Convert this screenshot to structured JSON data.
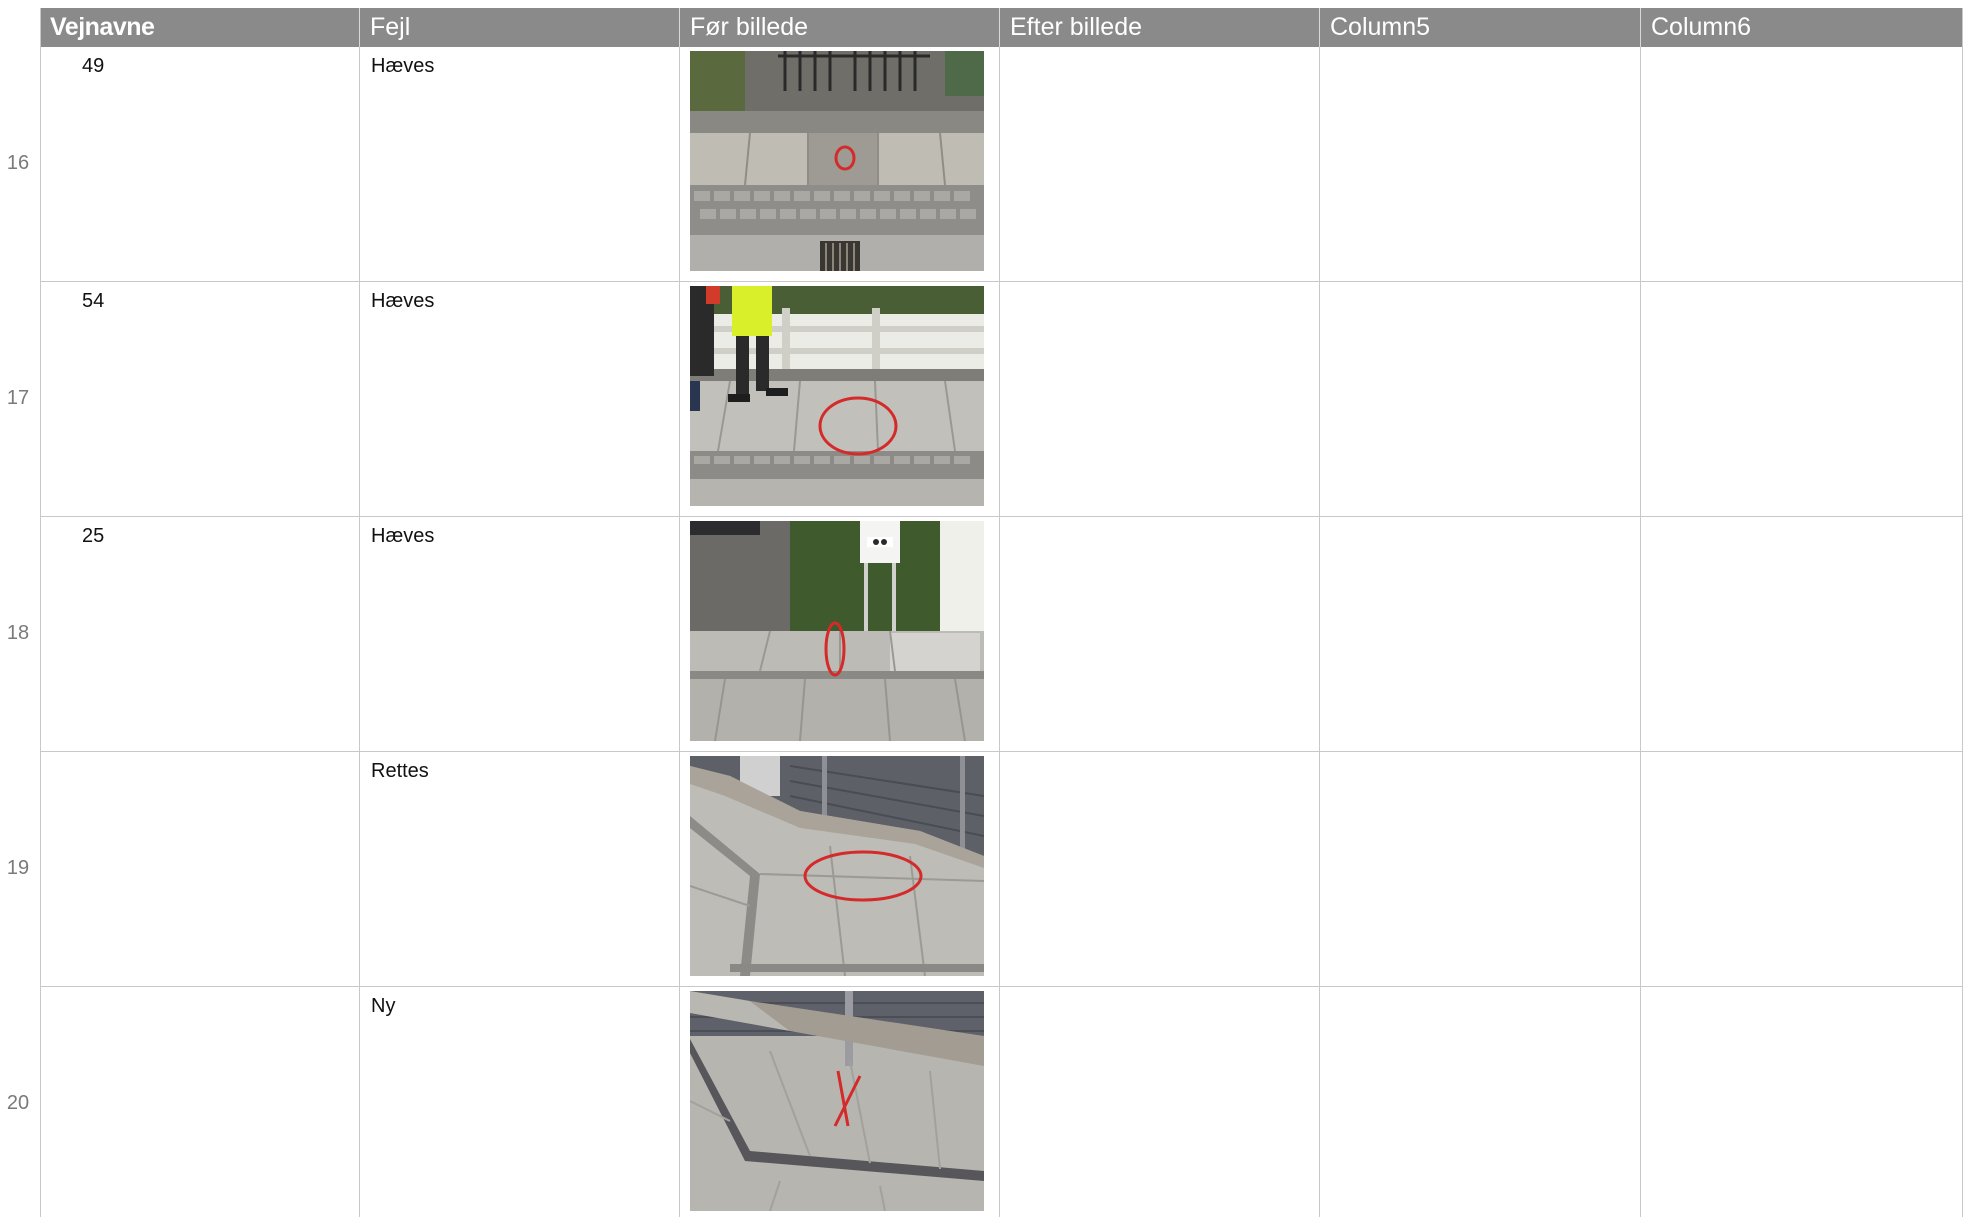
{
  "sheet": {
    "columns": [
      "Vejnavne",
      "Fejl",
      "Før billede",
      "Efter billede",
      "Column5",
      "Column6"
    ],
    "rows": [
      {
        "row_number": "16",
        "vejnavne": "49",
        "fejl": "Hæves",
        "foer_billede": "photo: paving slab near gate, red circle marking defect"
      },
      {
        "row_number": "17",
        "vejnavne": "54",
        "fejl": "Hæves",
        "foer_billede": "photo: sidewalk by white fence, workers, red circle marking defect"
      },
      {
        "row_number": "18",
        "vejnavne": "25",
        "fejl": "Hæves",
        "foer_billede": "photo: sidewalk near hedge and house number sign, red mark on defect"
      },
      {
        "row_number": "19",
        "vejnavne": "",
        "fejl": "Rettes",
        "foer_billede": "photo: paving corner by grey fence, red circle marking defect"
      },
      {
        "row_number": "20",
        "vejnavne": "",
        "fejl": "Ny",
        "foer_billede": "photo: paving corner by grey fence, red X marking location"
      }
    ]
  },
  "colors": {
    "header_bg": "#8a8a8a",
    "header_text": "#ffffff",
    "grid_line": "#c8c8c8",
    "row_number": "#7a7a7a",
    "annotation_red": "#d42a2a"
  }
}
